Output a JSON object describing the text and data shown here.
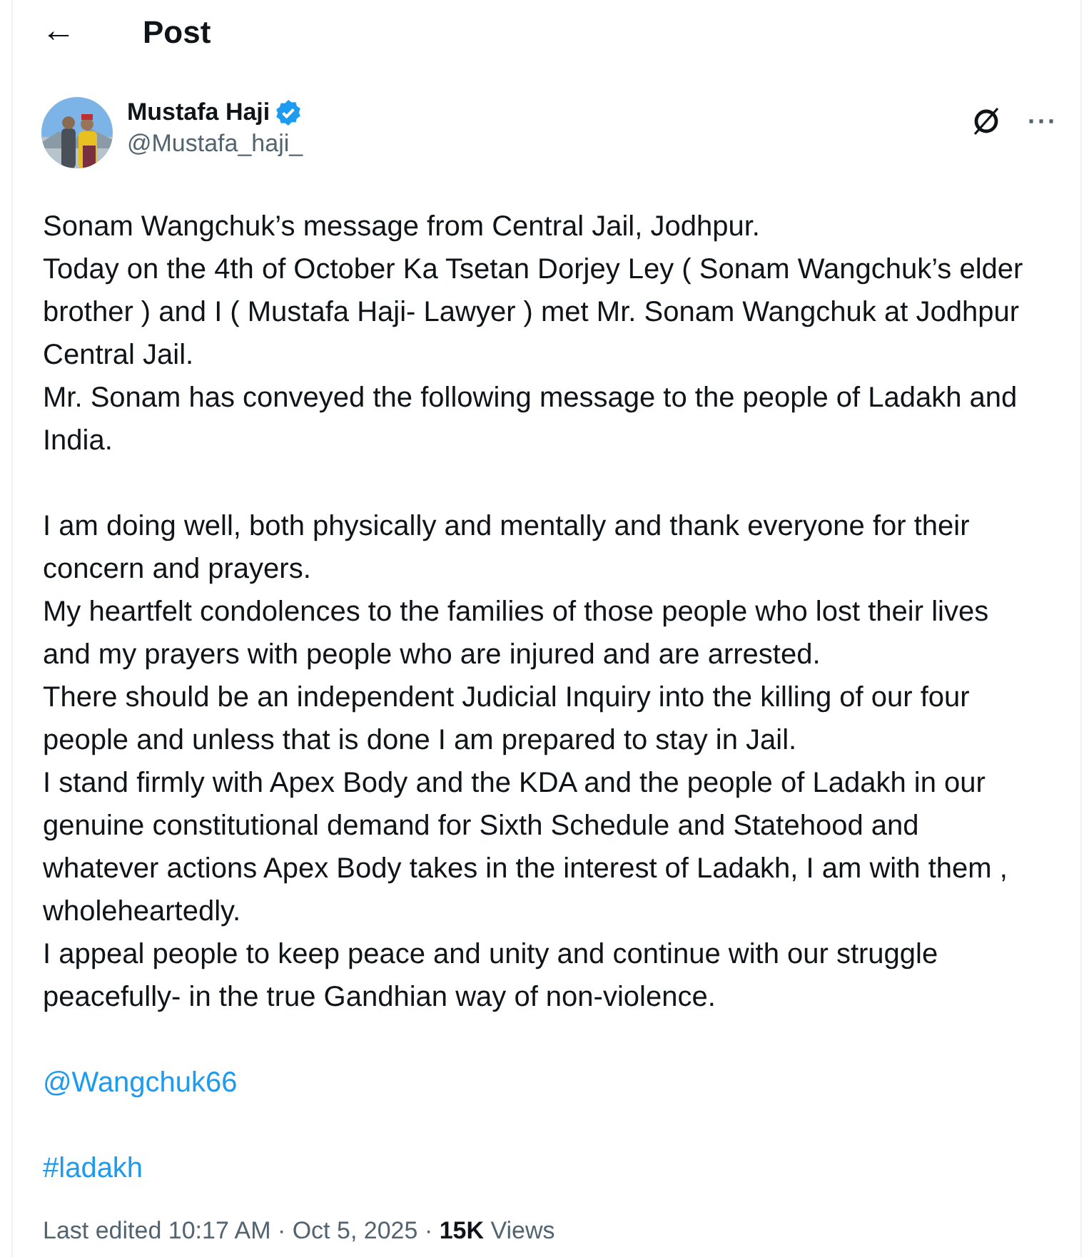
{
  "header": {
    "back": "←",
    "title": "Post"
  },
  "author": {
    "name": "Mustafa Haji",
    "verified": true,
    "handle": "@Mustafa_haji_"
  },
  "actions": {
    "more": "···"
  },
  "body": [
    {
      "kind": "line",
      "text": "Sonam Wangchuk’s message from Central Jail, Jodhpur."
    },
    {
      "kind": "line",
      "text": "Today on the 4th of October Ka Tsetan Dorjey Ley ( Sonam Wangchuk’s elder brother ) and I ( Mustafa Haji- Lawyer ) met Mr. Sonam Wangchuk at Jodhpur Central Jail."
    },
    {
      "kind": "line",
      "text": "Mr. Sonam has conveyed the following message to the people of Ladakh and India."
    },
    {
      "kind": "gap"
    },
    {
      "kind": "line",
      "text": "I am doing well, both physically and mentally and thank everyone for their concern and prayers."
    },
    {
      "kind": "line",
      "text": "My heartfelt condolences to the families of those people who lost their lives and my prayers with people who are injured and are arrested."
    },
    {
      "kind": "line",
      "text": "There should be an independent Judicial Inquiry into the killing of our four people and unless that is done I am prepared to stay in Jail."
    },
    {
      "kind": "line",
      "text": "I stand firmly with Apex Body and the KDA and the people of Ladakh in our genuine constitutional demand for Sixth Schedule and Statehood and whatever actions Apex Body takes in the interest of Ladakh, I am with them , wholeheartedly."
    },
    {
      "kind": "line",
      "text": "I appeal people to keep peace and unity and continue with our struggle peacefully- in the true Gandhian way of non-violence."
    },
    {
      "kind": "gap"
    },
    {
      "kind": "mention",
      "text": "@Wangchuk66"
    },
    {
      "kind": "gap"
    },
    {
      "kind": "hashtag",
      "text": "#ladakh"
    }
  ],
  "footer": "Last edited 10:17 AM · Oct 5, 2025 · **15K** Views"
}
